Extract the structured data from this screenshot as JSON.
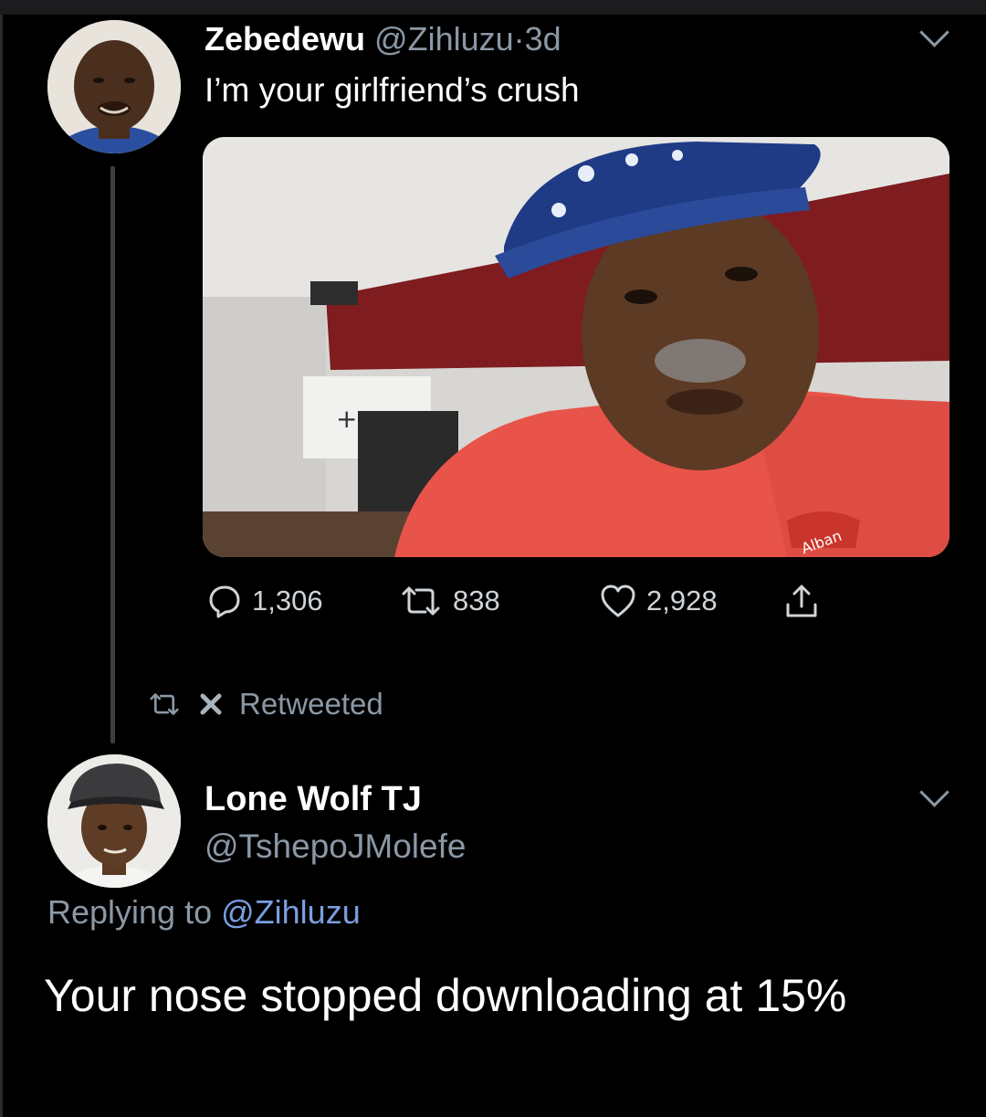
{
  "tweet": {
    "display_name": "Zebedewu",
    "handle": "@Zihluzu",
    "separator": "·",
    "time": "3d",
    "text": "I’m your girlfriend’s crush",
    "stats": {
      "replies": "1,306",
      "retweets": "838",
      "likes": "2,928"
    },
    "photo_shirt_logo_text": "Alban"
  },
  "retweet_banner": {
    "label": "Retweeted"
  },
  "reply": {
    "display_name": "Lone Wolf TJ",
    "handle": "@TshepoJMolefe",
    "replying_prefix": "Replying to",
    "replying_to": "@Zihluzu",
    "text": "Your nose stopped downloading at 15%"
  },
  "icons": {
    "menu": "chevron-down-icon",
    "reply": "reply-bubble-icon",
    "retweet": "retweet-icon",
    "like": "heart-icon",
    "share": "share-icon",
    "x": "x-close-icon"
  },
  "colors": {
    "background": "#000000",
    "text": "#ffffff",
    "muted": "#8b98a5",
    "link": "#7a9fe0"
  }
}
